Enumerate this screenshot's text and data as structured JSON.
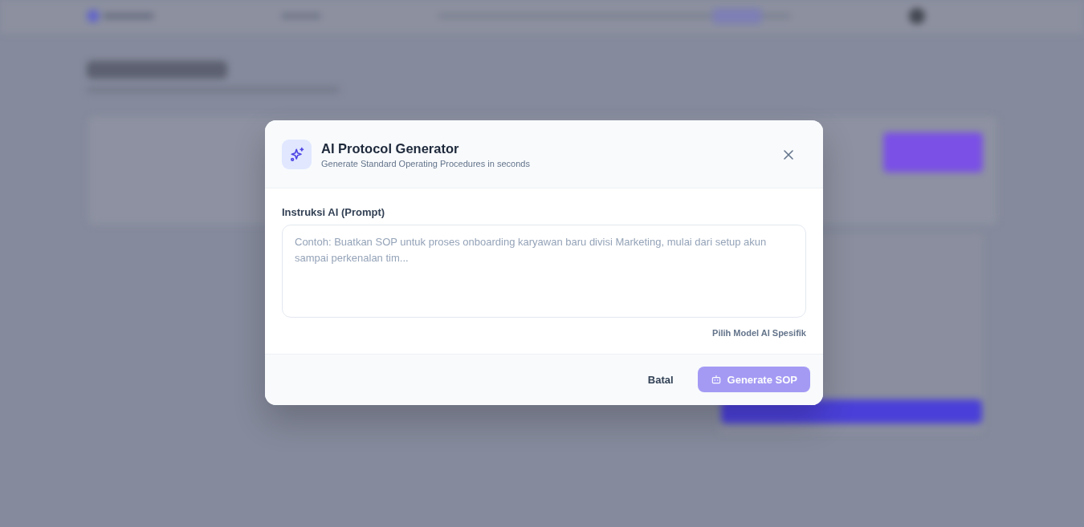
{
  "dialog": {
    "title": "AI Protocol Generator",
    "subtitle": "Generate Standard Operating Procedures in seconds",
    "prompt_field": {
      "label": "Instruksi AI (Prompt)",
      "placeholder": "Contoh: Buatkan SOP untuk proses onboarding karyawan baru divisi Marketing, mulai dari setup akun sampai perkenalan tim..."
    },
    "model_link": "Pilih Model AI Spesifik",
    "buttons": [
      {
        "kind": "text",
        "label": "Batal",
        "disabled": false
      },
      {
        "kind": "primary",
        "label": "Generate SOP",
        "disabled": true
      }
    ]
  }
}
